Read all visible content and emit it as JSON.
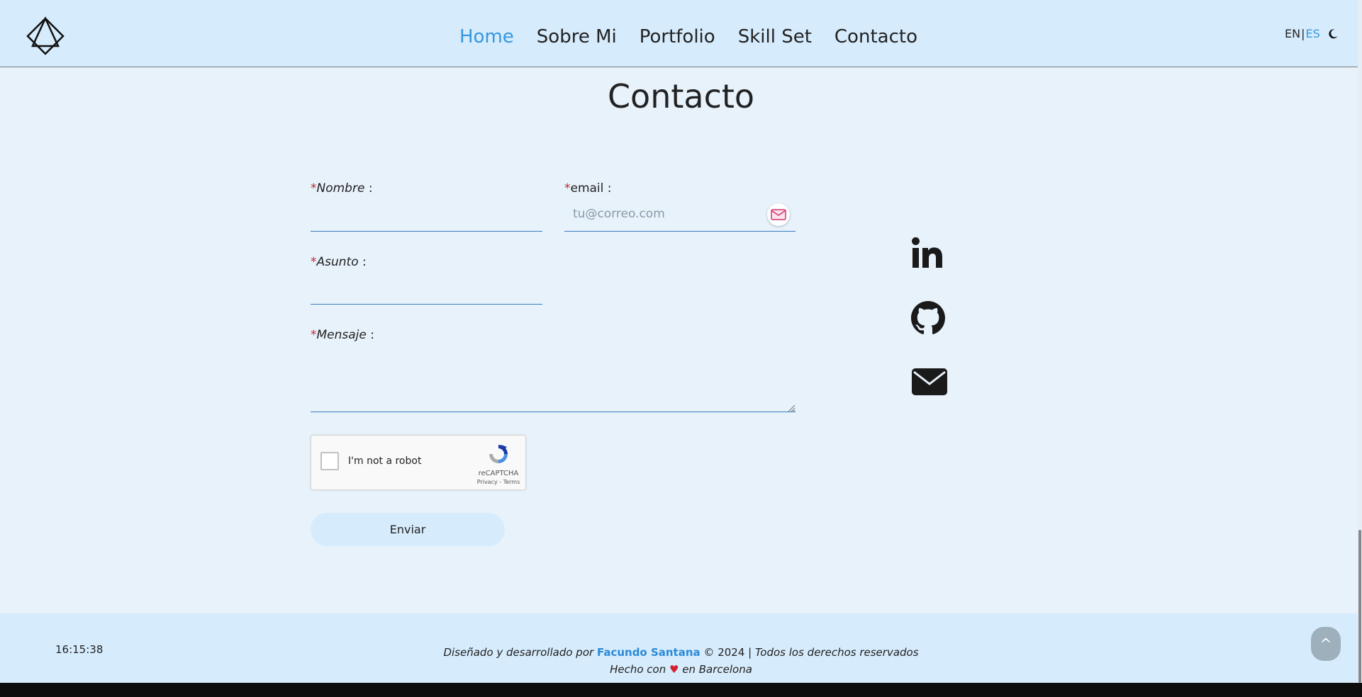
{
  "nav": {
    "links": [
      "Home",
      "Sobre Mi",
      "Portfolio",
      "Skill Set",
      "Contacto"
    ],
    "active": "Home",
    "lang_en": "EN",
    "lang_sep": "|",
    "lang_es": "ES"
  },
  "page": {
    "title": "Contacto"
  },
  "form": {
    "required_mark": "*",
    "nombre_label": "Nombre",
    "email_label": "email",
    "email_placeholder": "tu@correo.com",
    "asunto_label": "Asunto",
    "mensaje_label": "Mensaje",
    "label_suffix": " :",
    "captcha_label": "I'm not a robot",
    "captcha_brand": "reCAPTCHA",
    "captcha_links": "Privacy - Terms",
    "submit_label": "Enviar"
  },
  "social": {
    "icons": [
      "linkedin-icon",
      "github-icon",
      "mail-icon"
    ]
  },
  "footer": {
    "clock": "16:15:38",
    "designed_by": "Diseñado y desarrollado por",
    "author": "Facundo Santana",
    "year": "© 2024 |",
    "rights": "Todos los derechos reservados",
    "made_with": "Hecho con",
    "heart": "♥",
    "city": "en Barcelona",
    "top_button": "^"
  },
  "colors": {
    "accent": "#3598e0",
    "nav_bg": "#d6ebfc",
    "page_bg": "#e8f2fb",
    "required": "#c0262d"
  }
}
